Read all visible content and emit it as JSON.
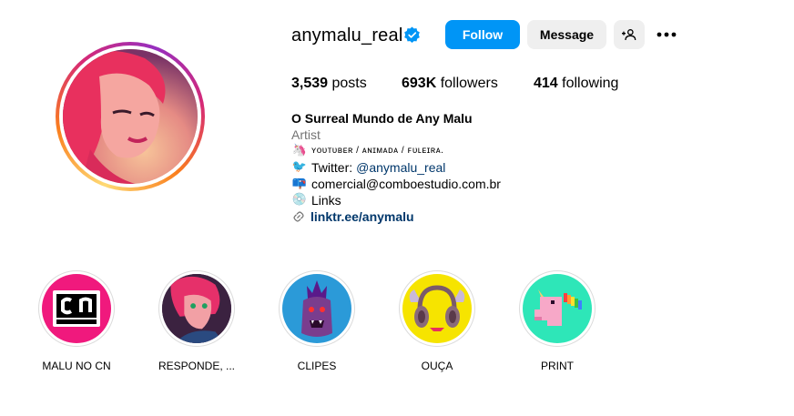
{
  "profile": {
    "username": "anymalu_real",
    "verified": true,
    "follow_label": "Follow",
    "message_label": "Message"
  },
  "stats": {
    "posts_count": "3,539",
    "posts_label": "posts",
    "followers_count": "693K",
    "followers_label": "followers",
    "following_count": "414",
    "following_label": "following"
  },
  "bio": {
    "name": "O Surreal Mundo de Any Malu",
    "category": "Artist",
    "line1_text": "ʏᴏᴜᴛᴜʙᴇʀ / ᴀɴɪᴍᴀᴅᴀ / ꜰᴜʟᴇɪʀᴀ.",
    "line2_prefix": "Twitter:",
    "line2_handle": "@anymalu_real",
    "line3_text": "comercial@comboestudio.com.br",
    "line4_text": "Links",
    "link": "linktr.ee/anymalu"
  },
  "highlights": [
    {
      "label": "MALU NO CN",
      "bg": "#f0197d"
    },
    {
      "label": "RESPONDE, ...",
      "bg": "#4a2a4a"
    },
    {
      "label": "CLIPES",
      "bg": "#2b9ad8"
    },
    {
      "label": "OUÇA",
      "bg": "#f6e400"
    },
    {
      "label": "PRINT",
      "bg": "#2ee6b8"
    }
  ],
  "colors": {
    "accent": "#0095f6",
    "link": "#00376b",
    "secondary_text": "#737373"
  },
  "icons": {
    "verified": "verified-badge-icon",
    "add_user": "add-user-icon",
    "more": "more-options-icon",
    "link": "link-icon"
  }
}
